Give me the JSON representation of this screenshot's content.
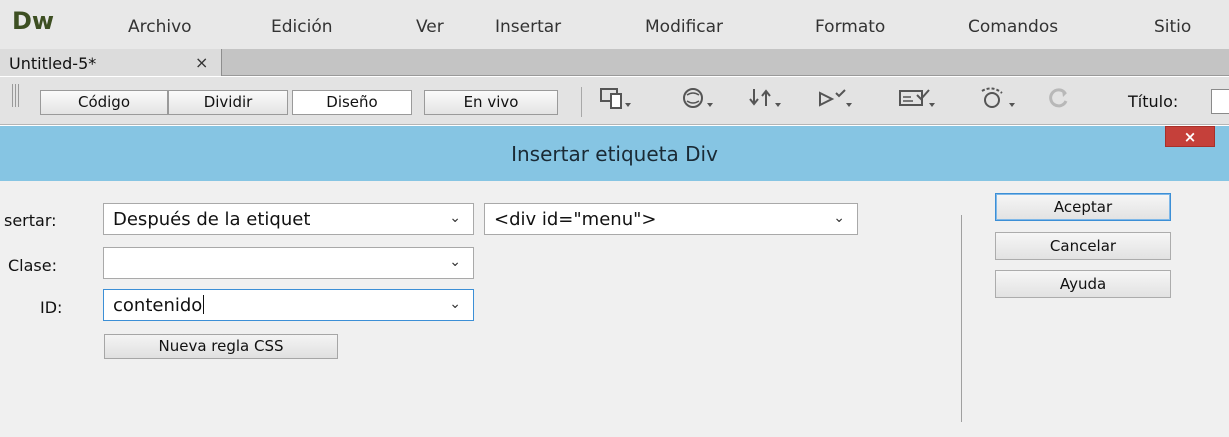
{
  "app": {
    "logo": "Dw"
  },
  "menu": [
    "Archivo",
    "Edición",
    "Ver",
    "Insertar",
    "Modificar",
    "Formato",
    "Comandos",
    "Sitio"
  ],
  "tab": {
    "label": "Untitled-5*",
    "close": "×"
  },
  "toolbar": {
    "views": [
      "Código",
      "Dividir",
      "Diseño",
      "En vivo"
    ],
    "active_view": "Diseño",
    "icons": [
      "multiscreen-icon",
      "preview-browser-icon",
      "file-management-icon",
      "w3c-validation-icon",
      "visual-aids-icon",
      "check-browser-compat-icon",
      "refresh-icon"
    ],
    "title_label": "Título:"
  },
  "dialog": {
    "title": "Insertar etiqueta Div",
    "close": "×",
    "insert_label": "sertar:",
    "insert_position": "Después de la etiquet",
    "insert_target": "<div id=\"menu\">",
    "class_label": "Clase:",
    "class_value": "",
    "id_label": "ID:",
    "id_value": "contenido",
    "new_css_rule": "Nueva regla CSS",
    "ok": "Aceptar",
    "cancel": "Cancelar",
    "help": "Ayuda"
  },
  "colors": {
    "dialog_titlebar": "#86c5e3",
    "close_button": "#c5403a",
    "focus_border": "#3c8fd6"
  }
}
